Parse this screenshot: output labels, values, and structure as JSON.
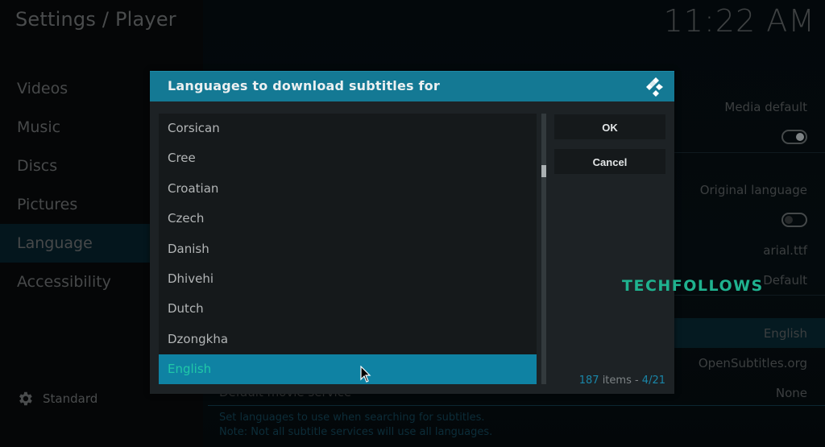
{
  "header": {
    "breadcrumb": "Settings / Player",
    "clock": "11:22 AM"
  },
  "sidebar": {
    "items": [
      {
        "label": "Videos",
        "active": false
      },
      {
        "label": "Music",
        "active": false
      },
      {
        "label": "Discs",
        "active": false
      },
      {
        "label": "Pictures",
        "active": false
      },
      {
        "label": "Language",
        "active": true
      },
      {
        "label": "Accessibility",
        "active": false
      }
    ],
    "settings_level": {
      "icon": "gear-icon",
      "label": "Standard"
    }
  },
  "background_settings": {
    "values": {
      "media_default": "Media default",
      "original_language": "Original language",
      "font": "arial.ttf",
      "default": "Default",
      "languages": "English",
      "tv_service": "OpenSubtitles.org",
      "movie_service": "None"
    },
    "toggles": [
      {
        "name": "toggle-1",
        "on": true
      },
      {
        "name": "toggle-2",
        "on": false
      }
    ],
    "partial_label": "Default movie service",
    "help_text": [
      "Set languages to use when searching for subtitles.",
      "Note: Not all subtitle services will use all languages."
    ]
  },
  "dialog": {
    "title": "Languages to download subtitles for",
    "logo_icon": "kodi-logo-icon",
    "list_items": [
      {
        "label": "Corsican",
        "selected": false
      },
      {
        "label": "Cree",
        "selected": false
      },
      {
        "label": "Croatian",
        "selected": false
      },
      {
        "label": "Czech",
        "selected": false
      },
      {
        "label": "Danish",
        "selected": false
      },
      {
        "label": "Dhivehi",
        "selected": false
      },
      {
        "label": "Dutch",
        "selected": false
      },
      {
        "label": "Dzongkha",
        "selected": false
      },
      {
        "label": "English",
        "selected": true
      }
    ],
    "ok_label": "OK",
    "cancel_label": "Cancel",
    "item_count": "187",
    "items_word": " items - ",
    "page": "4/21"
  },
  "watermark": "TECHFOLLOWS",
  "colors": {
    "accent": "#147994",
    "selection": "#0f82a3",
    "selected_text": "#20c8a8",
    "watermark": "#1fb28f"
  }
}
